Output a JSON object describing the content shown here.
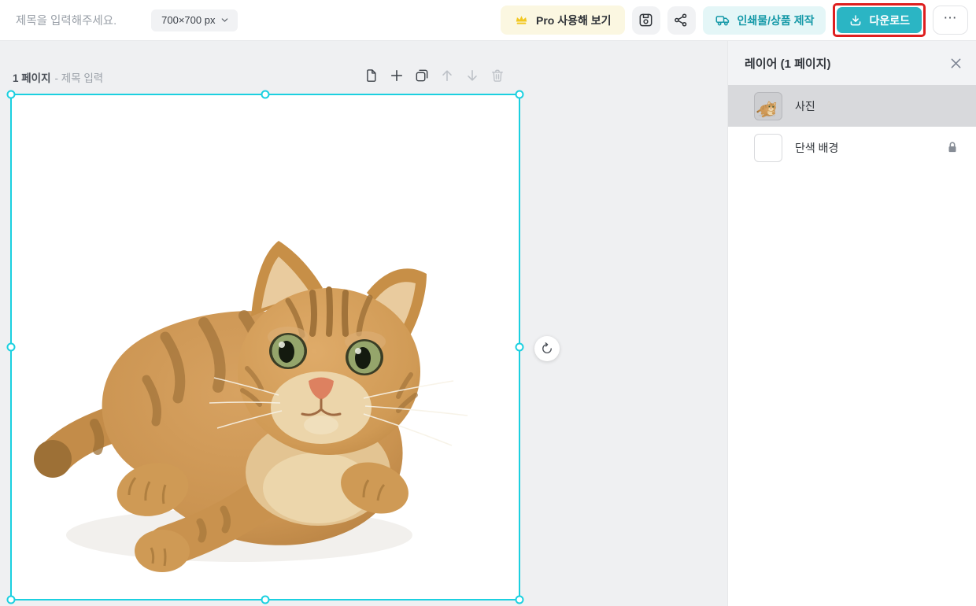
{
  "topbar": {
    "title_placeholder": "제목을 입력해주세요.",
    "size_selector": "700×700 px",
    "pro_button": "Pro 사용해 보기",
    "print_button": "인쇄물/상품 제작",
    "download_button": "다운로드",
    "more_button": "⋯"
  },
  "canvas_area": {
    "page_indicator": "1 페이지",
    "page_title_hint": "- 제목 입력"
  },
  "layers_panel": {
    "title": "레이어 (1 페이지)",
    "layers": [
      {
        "label": "사진",
        "selected": true,
        "locked": false
      },
      {
        "label": "단색 배경",
        "selected": false,
        "locked": true
      }
    ]
  },
  "icons": [
    "chevron-down-icon",
    "crown-icon",
    "save-icon",
    "share-icon",
    "truck-icon",
    "download-icon",
    "more-icon",
    "new-page-icon",
    "add-page-icon",
    "duplicate-page-icon",
    "move-up-icon",
    "move-down-icon",
    "delete-page-icon",
    "rotate-icon",
    "close-icon",
    "lock-icon"
  ],
  "colors": {
    "accent_cyan": "#1bd0e0",
    "download_teal": "#2bb5c4",
    "print_teal_text": "#1599a8",
    "print_bg": "#e4f6f7",
    "pro_bg": "#fbf7e1",
    "crown_gold": "#f2c71f",
    "annotation_red": "#de1f1f",
    "workspace_bg": "#eff0f2",
    "panel_header_bg": "#f2f3f5",
    "selected_layer_bg": "#d8d9dc"
  }
}
